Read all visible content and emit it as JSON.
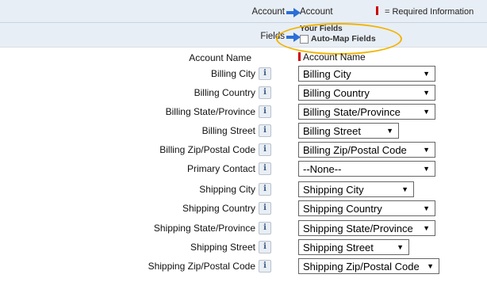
{
  "header": {
    "row1": {
      "left_label": "Account",
      "right_value": "Account",
      "required_legend": "= Required Information"
    },
    "row2": {
      "left_label": "Fields",
      "your_fields": "Your Fields",
      "auto_map": "Auto-Map Fields",
      "auto_map_checked": false
    }
  },
  "account_name": {
    "label": "Account Name",
    "value": "Account Name",
    "required": true
  },
  "fields": [
    {
      "label": "Billing City",
      "value": "Billing City"
    },
    {
      "label": "Billing Country",
      "value": "Billing Country"
    },
    {
      "label": "Billing State/Province",
      "value": "Billing State/Province"
    },
    {
      "label": "Billing Street",
      "value": "Billing Street"
    },
    {
      "label": "Billing Zip/Postal Code",
      "value": "Billing Zip/Postal Code"
    },
    {
      "label": "Primary Contact",
      "value": "--None--"
    },
    {
      "label": "Shipping City",
      "value": "Shipping City"
    },
    {
      "label": "Shipping Country",
      "value": "Shipping Country"
    },
    {
      "label": "Shipping State/Province",
      "value": "Shipping State/Province"
    },
    {
      "label": "Shipping Street",
      "value": "Shipping Street"
    },
    {
      "label": "Shipping Zip/Postal Code",
      "value": "Shipping Zip/Postal Code"
    }
  ],
  "info_icon_glyph": "i",
  "colors": {
    "arrow": "#2b6fd6",
    "required": "#cc0000",
    "highlight": "#f0b400",
    "header_bg": "#e8eef5"
  }
}
